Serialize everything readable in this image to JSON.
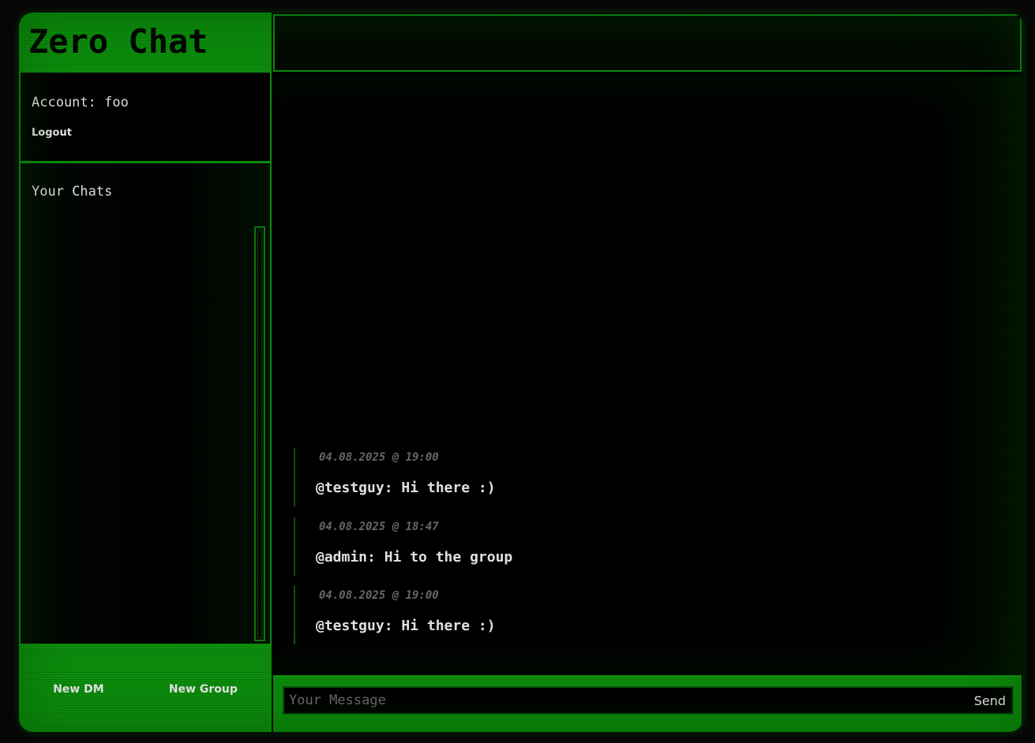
{
  "app": {
    "title": "Zero Chat"
  },
  "account": {
    "label": "Account: foo",
    "logout_label": "Logout"
  },
  "chats": {
    "title": "Your Chats",
    "items": []
  },
  "actions": {
    "new_dm_label": "New DM",
    "new_group_label": "New Group"
  },
  "messages": [
    {
      "timestamp": "04.08.2025 @ 19:00",
      "text": "@testguy: Hi there :)"
    },
    {
      "timestamp": "04.08.2025 @ 18:47",
      "text": "@admin: Hi to the group"
    },
    {
      "timestamp": "04.08.2025 @ 19:00",
      "text": "@testguy: Hi there :)"
    }
  ],
  "composer": {
    "placeholder": "Your Message",
    "value": "",
    "send_label": "Send"
  },
  "colors": {
    "accent": "#0c8f0c",
    "background": "#000000",
    "text": "#e6e6e6",
    "muted": "#6a6a6a"
  }
}
